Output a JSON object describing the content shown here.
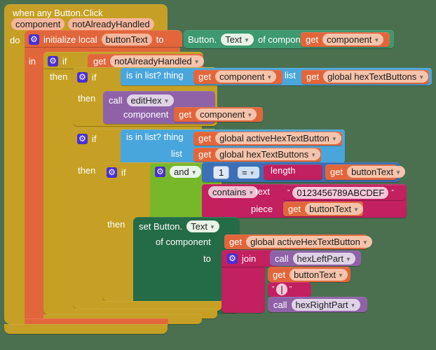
{
  "canvas": {
    "background": "#4a7050",
    "app": "MIT App Inventor Blocks Editor"
  },
  "palette": {
    "event": "#c5a024",
    "control": "#c5a024",
    "variable": "#e2663b",
    "list": "#49a6dc",
    "logic": "#77b82a",
    "math": "#3b6fb6",
    "text": "#c2205f",
    "procedure": "#8f62a8",
    "component_get": "#3d9970",
    "component_set": "#246b47",
    "mutator": "#4a2fd0"
  },
  "event_block": {
    "title": "when any Button.Click",
    "params": [
      "component",
      "notAlreadyHandled"
    ],
    "do_label": "do"
  },
  "init_local": {
    "keyword": "initialize local",
    "var_name": "buttonText",
    "to_label": "to",
    "in_label": "in"
  },
  "component_getter": {
    "prefix": "Button.",
    "property": "Text",
    "of_component_label": "of component",
    "arg": {
      "keyword": "get",
      "name": "component"
    }
  },
  "if1": {
    "if_label": "if",
    "then_label": "then",
    "condition": {
      "keyword": "get",
      "name": "notAlreadyHandled"
    }
  },
  "if2": {
    "if_label": "if",
    "then_label": "then",
    "list_test": {
      "thing_label": "is in list? thing",
      "list_label": "list",
      "thing": {
        "keyword": "get",
        "name": "component"
      },
      "list": {
        "keyword": "get",
        "name": "global hexTextButtons"
      }
    },
    "body": {
      "call_label": "call",
      "procedure": "editHex",
      "arg_label": "component",
      "arg": {
        "keyword": "get",
        "name": "component"
      }
    }
  },
  "if3": {
    "if_label": "if",
    "then_label": "then",
    "list_test": {
      "thing_label": "is in list? thing",
      "list_label": "list",
      "thing": {
        "keyword": "get",
        "name": "global activeHexTextButton"
      },
      "list": {
        "keyword": "get",
        "name": "global hexTextButtons"
      }
    }
  },
  "if4": {
    "if_label": "if",
    "then_label": "then",
    "and_label": "and",
    "compare": {
      "left_value": "1",
      "operator": "=",
      "length_label": "length",
      "arg": {
        "keyword": "get",
        "name": "buttonText"
      }
    },
    "contains": {
      "op": "contains",
      "text_label": "text",
      "piece_label": "piece",
      "quote_open": "”",
      "quote_close": "”",
      "text_value": "0123456789ABCDEF",
      "piece": {
        "keyword": "get",
        "name": "buttonText"
      }
    }
  },
  "setter": {
    "prefix": "set Button.",
    "property": "Text",
    "of_component_label": "of component",
    "of_component_arg": {
      "keyword": "get",
      "name": "global activeHexTextButton"
    },
    "to_label": "to",
    "join_label": "join",
    "join_items": [
      {
        "type": "call",
        "call_label": "call",
        "procedure": "hexLeftPart"
      },
      {
        "type": "get",
        "keyword": "get",
        "name": "buttonText"
      },
      {
        "type": "text",
        "quote_open": "”",
        "quote_close": "”",
        "value": "|"
      },
      {
        "type": "call",
        "call_label": "call",
        "procedure": "hexRightPart"
      }
    ]
  }
}
